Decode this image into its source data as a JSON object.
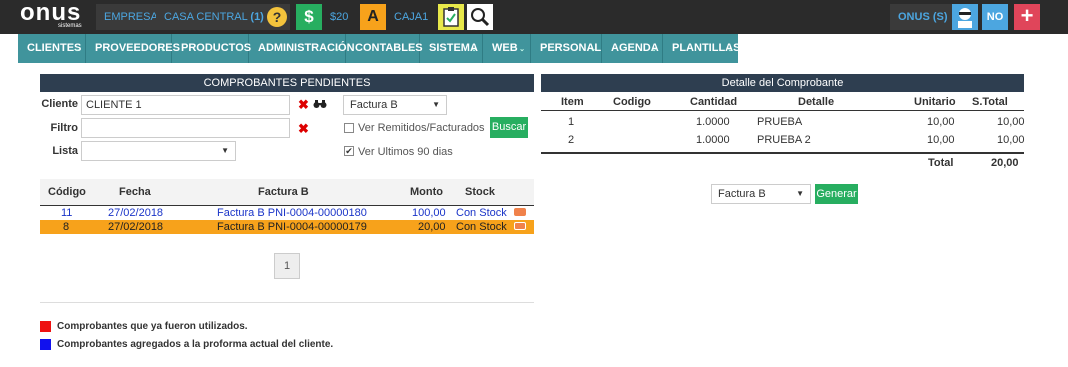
{
  "topbar": {
    "logo_word": "onus",
    "logo_sub": "sistemas",
    "empresa": "EMPRESA",
    "casa_central": "CASA CENTRAL",
    "casa_count": "(1)",
    "dollar_icon": "$",
    "amount": "$20",
    "a_icon": "A",
    "caja": "CAJA1",
    "user": "ONUS (S)",
    "no": "NO",
    "plus": "+"
  },
  "nav": [
    "CLIENTES",
    "PROVEEDORES",
    "PRODUCTOS",
    "ADMINISTRACIÓN",
    "CONTABLES",
    "SISTEMA",
    "WEB",
    "PERSONAL",
    "AGENDA",
    "PLANTILLAS"
  ],
  "left": {
    "title": "COMPROBANTES PENDIENTES",
    "cliente_label": "Cliente",
    "cliente_value": "CLIENTE 1",
    "filtro_label": "Filtro",
    "filtro_value": "",
    "lista_label": "Lista",
    "lista_value": "",
    "tipo_value": "Factura B",
    "ver_remitidos": "Ver Remitidos/Facturados",
    "ver_ultimos": "Ver Ultimos 90 dias",
    "buscar": "Buscar",
    "headers": {
      "codigo": "Código",
      "fecha": "Fecha",
      "factura": "Factura B",
      "monto": "Monto",
      "stock": "Stock"
    },
    "rows": [
      {
        "codigo": "11",
        "fecha": "27/02/2018",
        "factura": "Factura B PNI-0004-00000180",
        "monto": "100,00",
        "stock": "Con Stock"
      },
      {
        "codigo": "8",
        "fecha": "27/02/2018",
        "factura": "Factura B PNI-0004-00000179",
        "monto": "20,00",
        "stock": "Con Stock"
      }
    ],
    "page": "1",
    "legend": [
      {
        "color": "#ee1111",
        "text": "Comprobantes que ya fueron utilizados."
      },
      {
        "color": "#1111ee",
        "text": "Comprobantes agregados a la proforma actual del cliente."
      }
    ]
  },
  "right": {
    "title": "Detalle del Comprobante",
    "headers": {
      "item": "Item",
      "codigo": "Codigo",
      "cantidad": "Cantidad",
      "detalle": "Detalle",
      "unitario": "Unitario",
      "stotal": "S.Total"
    },
    "rows": [
      {
        "item": "1",
        "codigo": "",
        "cantidad": "1.0000",
        "detalle": "PRUEBA",
        "unitario": "10,00",
        "stotal": "10,00"
      },
      {
        "item": "2",
        "codigo": "",
        "cantidad": "1.0000",
        "detalle": "PRUEBA 2",
        "unitario": "10,00",
        "stotal": "10,00"
      }
    ],
    "total_label": "Total",
    "total_value": "20,00",
    "gen_select": "Factura B",
    "generar": "Generar"
  },
  "colors": {
    "topbar": "#2b2b2b",
    "nav": "#40949c",
    "panel_header": "#2e3e50",
    "highlight": "#f7a21b",
    "green": "#27ae60"
  }
}
